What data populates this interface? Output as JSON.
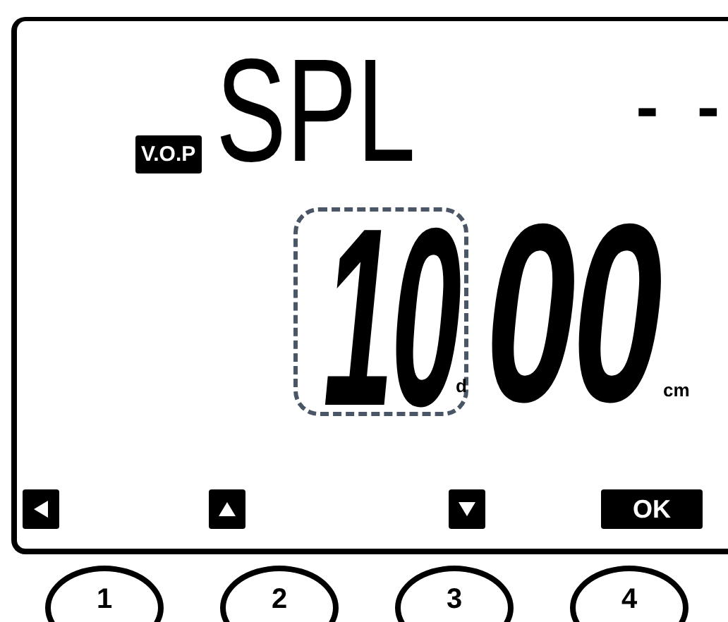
{
  "display": {
    "badge": "V.O.P",
    "mode": "SPL",
    "status": "- -",
    "reading": {
      "field": {
        "value": "10",
        "selected": true
      },
      "field_unit": "d",
      "value": "00",
      "unit": "cm"
    },
    "softkeys": [
      {
        "kind": "left"
      },
      {
        "kind": "up"
      },
      {
        "kind": "down"
      },
      {
        "kind": "text",
        "label": "OK"
      }
    ]
  },
  "buttons": [
    "1",
    "2",
    "3",
    "4"
  ]
}
